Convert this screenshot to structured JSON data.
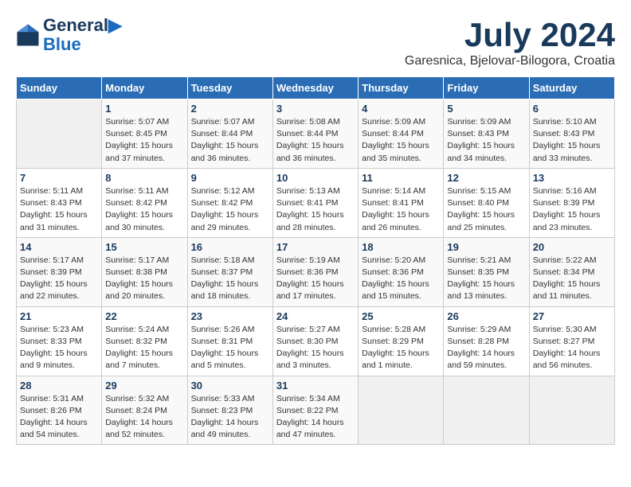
{
  "header": {
    "logo_line1": "General",
    "logo_line2": "Blue",
    "month": "July 2024",
    "location": "Garesnica, Bjelovar-Bilogora, Croatia"
  },
  "weekdays": [
    "Sunday",
    "Monday",
    "Tuesday",
    "Wednesday",
    "Thursday",
    "Friday",
    "Saturday"
  ],
  "weeks": [
    [
      {
        "day": "",
        "info": ""
      },
      {
        "day": "1",
        "info": "Sunrise: 5:07 AM\nSunset: 8:45 PM\nDaylight: 15 hours\nand 37 minutes."
      },
      {
        "day": "2",
        "info": "Sunrise: 5:07 AM\nSunset: 8:44 PM\nDaylight: 15 hours\nand 36 minutes."
      },
      {
        "day": "3",
        "info": "Sunrise: 5:08 AM\nSunset: 8:44 PM\nDaylight: 15 hours\nand 36 minutes."
      },
      {
        "day": "4",
        "info": "Sunrise: 5:09 AM\nSunset: 8:44 PM\nDaylight: 15 hours\nand 35 minutes."
      },
      {
        "day": "5",
        "info": "Sunrise: 5:09 AM\nSunset: 8:43 PM\nDaylight: 15 hours\nand 34 minutes."
      },
      {
        "day": "6",
        "info": "Sunrise: 5:10 AM\nSunset: 8:43 PM\nDaylight: 15 hours\nand 33 minutes."
      }
    ],
    [
      {
        "day": "7",
        "info": "Sunrise: 5:11 AM\nSunset: 8:43 PM\nDaylight: 15 hours\nand 31 minutes."
      },
      {
        "day": "8",
        "info": "Sunrise: 5:11 AM\nSunset: 8:42 PM\nDaylight: 15 hours\nand 30 minutes."
      },
      {
        "day": "9",
        "info": "Sunrise: 5:12 AM\nSunset: 8:42 PM\nDaylight: 15 hours\nand 29 minutes."
      },
      {
        "day": "10",
        "info": "Sunrise: 5:13 AM\nSunset: 8:41 PM\nDaylight: 15 hours\nand 28 minutes."
      },
      {
        "day": "11",
        "info": "Sunrise: 5:14 AM\nSunset: 8:41 PM\nDaylight: 15 hours\nand 26 minutes."
      },
      {
        "day": "12",
        "info": "Sunrise: 5:15 AM\nSunset: 8:40 PM\nDaylight: 15 hours\nand 25 minutes."
      },
      {
        "day": "13",
        "info": "Sunrise: 5:16 AM\nSunset: 8:39 PM\nDaylight: 15 hours\nand 23 minutes."
      }
    ],
    [
      {
        "day": "14",
        "info": "Sunrise: 5:17 AM\nSunset: 8:39 PM\nDaylight: 15 hours\nand 22 minutes."
      },
      {
        "day": "15",
        "info": "Sunrise: 5:17 AM\nSunset: 8:38 PM\nDaylight: 15 hours\nand 20 minutes."
      },
      {
        "day": "16",
        "info": "Sunrise: 5:18 AM\nSunset: 8:37 PM\nDaylight: 15 hours\nand 18 minutes."
      },
      {
        "day": "17",
        "info": "Sunrise: 5:19 AM\nSunset: 8:36 PM\nDaylight: 15 hours\nand 17 minutes."
      },
      {
        "day": "18",
        "info": "Sunrise: 5:20 AM\nSunset: 8:36 PM\nDaylight: 15 hours\nand 15 minutes."
      },
      {
        "day": "19",
        "info": "Sunrise: 5:21 AM\nSunset: 8:35 PM\nDaylight: 15 hours\nand 13 minutes."
      },
      {
        "day": "20",
        "info": "Sunrise: 5:22 AM\nSunset: 8:34 PM\nDaylight: 15 hours\nand 11 minutes."
      }
    ],
    [
      {
        "day": "21",
        "info": "Sunrise: 5:23 AM\nSunset: 8:33 PM\nDaylight: 15 hours\nand 9 minutes."
      },
      {
        "day": "22",
        "info": "Sunrise: 5:24 AM\nSunset: 8:32 PM\nDaylight: 15 hours\nand 7 minutes."
      },
      {
        "day": "23",
        "info": "Sunrise: 5:26 AM\nSunset: 8:31 PM\nDaylight: 15 hours\nand 5 minutes."
      },
      {
        "day": "24",
        "info": "Sunrise: 5:27 AM\nSunset: 8:30 PM\nDaylight: 15 hours\nand 3 minutes."
      },
      {
        "day": "25",
        "info": "Sunrise: 5:28 AM\nSunset: 8:29 PM\nDaylight: 15 hours\nand 1 minute."
      },
      {
        "day": "26",
        "info": "Sunrise: 5:29 AM\nSunset: 8:28 PM\nDaylight: 14 hours\nand 59 minutes."
      },
      {
        "day": "27",
        "info": "Sunrise: 5:30 AM\nSunset: 8:27 PM\nDaylight: 14 hours\nand 56 minutes."
      }
    ],
    [
      {
        "day": "28",
        "info": "Sunrise: 5:31 AM\nSunset: 8:26 PM\nDaylight: 14 hours\nand 54 minutes."
      },
      {
        "day": "29",
        "info": "Sunrise: 5:32 AM\nSunset: 8:24 PM\nDaylight: 14 hours\nand 52 minutes."
      },
      {
        "day": "30",
        "info": "Sunrise: 5:33 AM\nSunset: 8:23 PM\nDaylight: 14 hours\nand 49 minutes."
      },
      {
        "day": "31",
        "info": "Sunrise: 5:34 AM\nSunset: 8:22 PM\nDaylight: 14 hours\nand 47 minutes."
      },
      {
        "day": "",
        "info": ""
      },
      {
        "day": "",
        "info": ""
      },
      {
        "day": "",
        "info": ""
      }
    ]
  ]
}
